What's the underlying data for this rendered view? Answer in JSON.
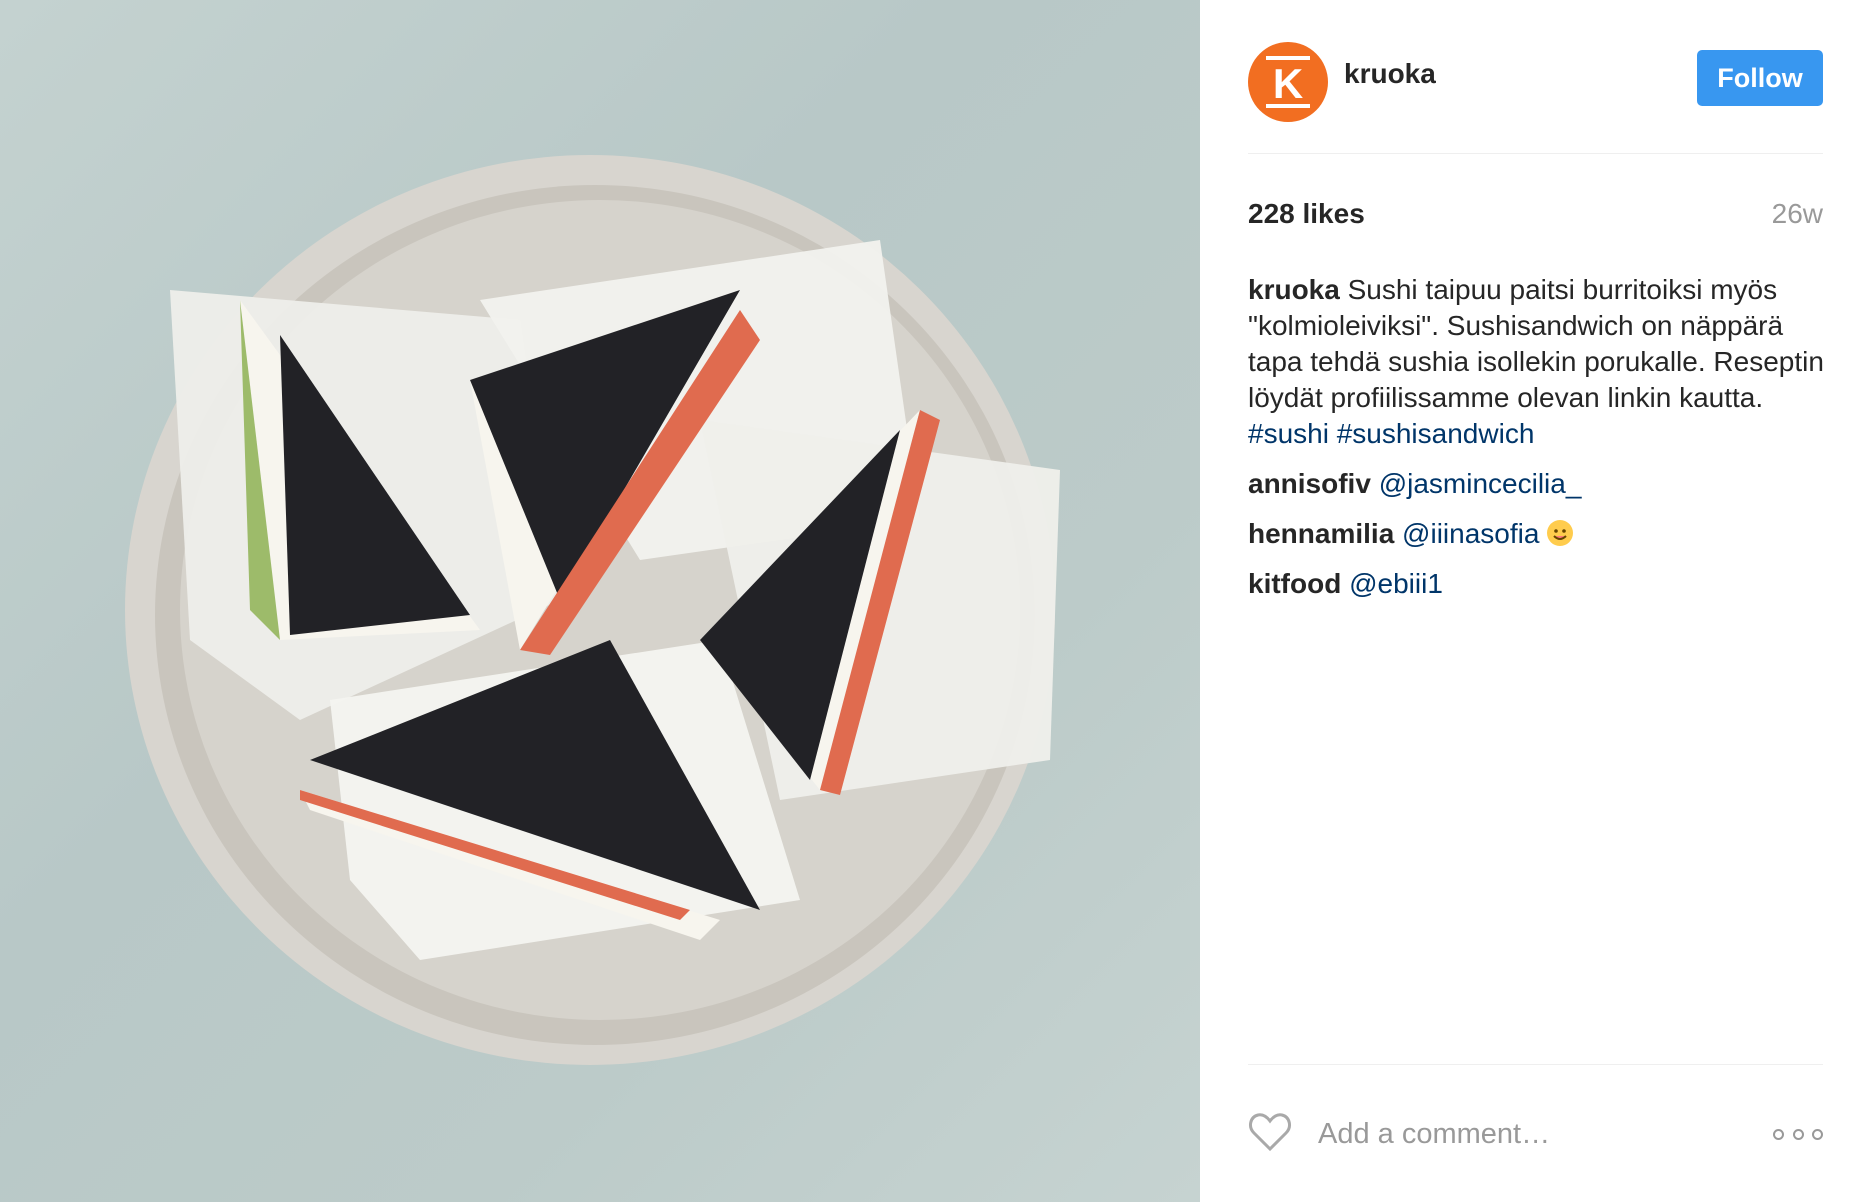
{
  "post": {
    "photo_alt": "Sushi sandwiches on a plate",
    "author": {
      "username": "kruoka",
      "avatar_letter": "K",
      "avatar_color": "#f26e21"
    },
    "follow_label": "Follow",
    "likes_text": "228 likes",
    "age": "26w",
    "caption": {
      "user": "kruoka",
      "text": "Sushi taipuu paitsi burritoiksi myös \"kolmioleiviksi\". Sushisandwich on näppärä tapa tehdä sushia isollekin porukalle. Reseptin löydät profiilissamme olevan linkin kautta.",
      "tags": [
        "#sushi",
        "#sushisandwich"
      ]
    },
    "comments": [
      {
        "user": "annisofiv",
        "text": "@jasmincecilia_",
        "emoji": ""
      },
      {
        "user": "hennamilia",
        "text": "@iiinasofia",
        "emoji": "smiling-face-icon"
      },
      {
        "user": "kitfood",
        "text": "@ebiii1",
        "emoji": ""
      }
    ],
    "comment_placeholder": "Add a comment…"
  },
  "colors": {
    "accent": "#3897f0",
    "link": "#003569",
    "muted": "#999999"
  }
}
